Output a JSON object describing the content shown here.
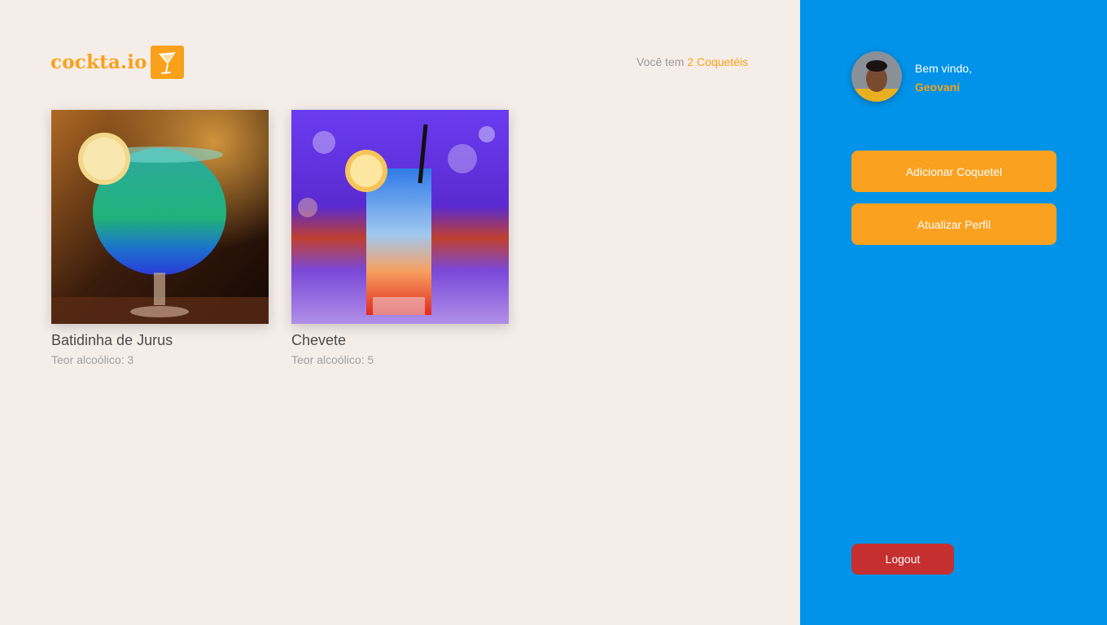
{
  "header": {
    "logo_text": "cockta.io",
    "logo_icon": "cocktail-glass-icon",
    "count_prefix": "Você tem",
    "count_highlight": "2 Coquetéis"
  },
  "cocktails": [
    {
      "name": "Batidinha de Jurus",
      "abv_text": "Teor alcoólico: 3"
    },
    {
      "name": "Chevete",
      "abv_text": "Teor alcoólico: 5"
    }
  ],
  "sidebar": {
    "welcome_label": "Bem vindo,",
    "user_name": "Geovani",
    "add_button": "Adicionar Coquetel",
    "update_button": "Atualizar Perfil",
    "logout_button": "Logout"
  },
  "colors": {
    "accent": "#f9a11b",
    "sidebar_bg": "#0093e9",
    "page_bg": "#f5ede8",
    "logout": "#c52f2f"
  }
}
